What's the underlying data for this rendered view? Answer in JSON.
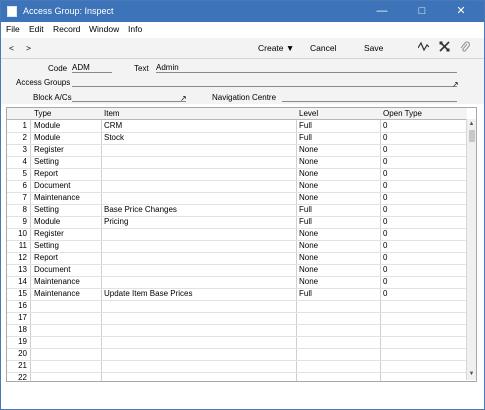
{
  "window": {
    "title": "Access Group: Inspect"
  },
  "menu": [
    "File",
    "Edit",
    "Record",
    "Window",
    "Info"
  ],
  "toolbar": {
    "back": "<",
    "forward": ">",
    "create": "Create",
    "cancel": "Cancel",
    "save": "Save"
  },
  "form": {
    "code_label": "Code",
    "code_value": "ADM",
    "text_label": "Text",
    "text_value": "Admin",
    "access_groups_label": "Access Groups",
    "access_groups_value": "",
    "block_acs_label": "Block A/Cs",
    "block_acs_value": "",
    "nav_centre_label": "Navigation Centre",
    "nav_centre_value": ""
  },
  "table": {
    "headers": [
      "Type",
      "Item",
      "Level",
      "Open Type"
    ],
    "rows": [
      {
        "n": "1",
        "type": "Module",
        "item": "CRM",
        "level": "Full",
        "open": "0"
      },
      {
        "n": "2",
        "type": "Module",
        "item": "Stock",
        "level": "Full",
        "open": "0"
      },
      {
        "n": "3",
        "type": "Register",
        "item": "",
        "level": "None",
        "open": "0"
      },
      {
        "n": "4",
        "type": "Setting",
        "item": "",
        "level": "None",
        "open": "0"
      },
      {
        "n": "5",
        "type": "Report",
        "item": "",
        "level": "None",
        "open": "0"
      },
      {
        "n": "6",
        "type": "Document",
        "item": "",
        "level": "None",
        "open": "0"
      },
      {
        "n": "7",
        "type": "Maintenance",
        "item": "",
        "level": "None",
        "open": "0"
      },
      {
        "n": "8",
        "type": "Setting",
        "item": "Base Price Changes",
        "level": "Full",
        "open": "0"
      },
      {
        "n": "9",
        "type": "Module",
        "item": "Pricing",
        "level": "Full",
        "open": "0"
      },
      {
        "n": "10",
        "type": "Register",
        "item": "",
        "level": "None",
        "open": "0"
      },
      {
        "n": "11",
        "type": "Setting",
        "item": "",
        "level": "None",
        "open": "0"
      },
      {
        "n": "12",
        "type": "Report",
        "item": "",
        "level": "None",
        "open": "0"
      },
      {
        "n": "13",
        "type": "Document",
        "item": "",
        "level": "None",
        "open": "0"
      },
      {
        "n": "14",
        "type": "Maintenance",
        "item": "",
        "level": "None",
        "open": "0"
      },
      {
        "n": "15",
        "type": "Maintenance",
        "item": "Update Item Base Prices",
        "level": "Full",
        "open": "0"
      },
      {
        "n": "16",
        "type": "",
        "item": "",
        "level": "",
        "open": ""
      },
      {
        "n": "17",
        "type": "",
        "item": "",
        "level": "",
        "open": ""
      },
      {
        "n": "18",
        "type": "",
        "item": "",
        "level": "",
        "open": ""
      },
      {
        "n": "19",
        "type": "",
        "item": "",
        "level": "",
        "open": ""
      },
      {
        "n": "20",
        "type": "",
        "item": "",
        "level": "",
        "open": ""
      },
      {
        "n": "21",
        "type": "",
        "item": "",
        "level": "",
        "open": ""
      },
      {
        "n": "22",
        "type": "",
        "item": "",
        "level": "",
        "open": ""
      }
    ]
  }
}
